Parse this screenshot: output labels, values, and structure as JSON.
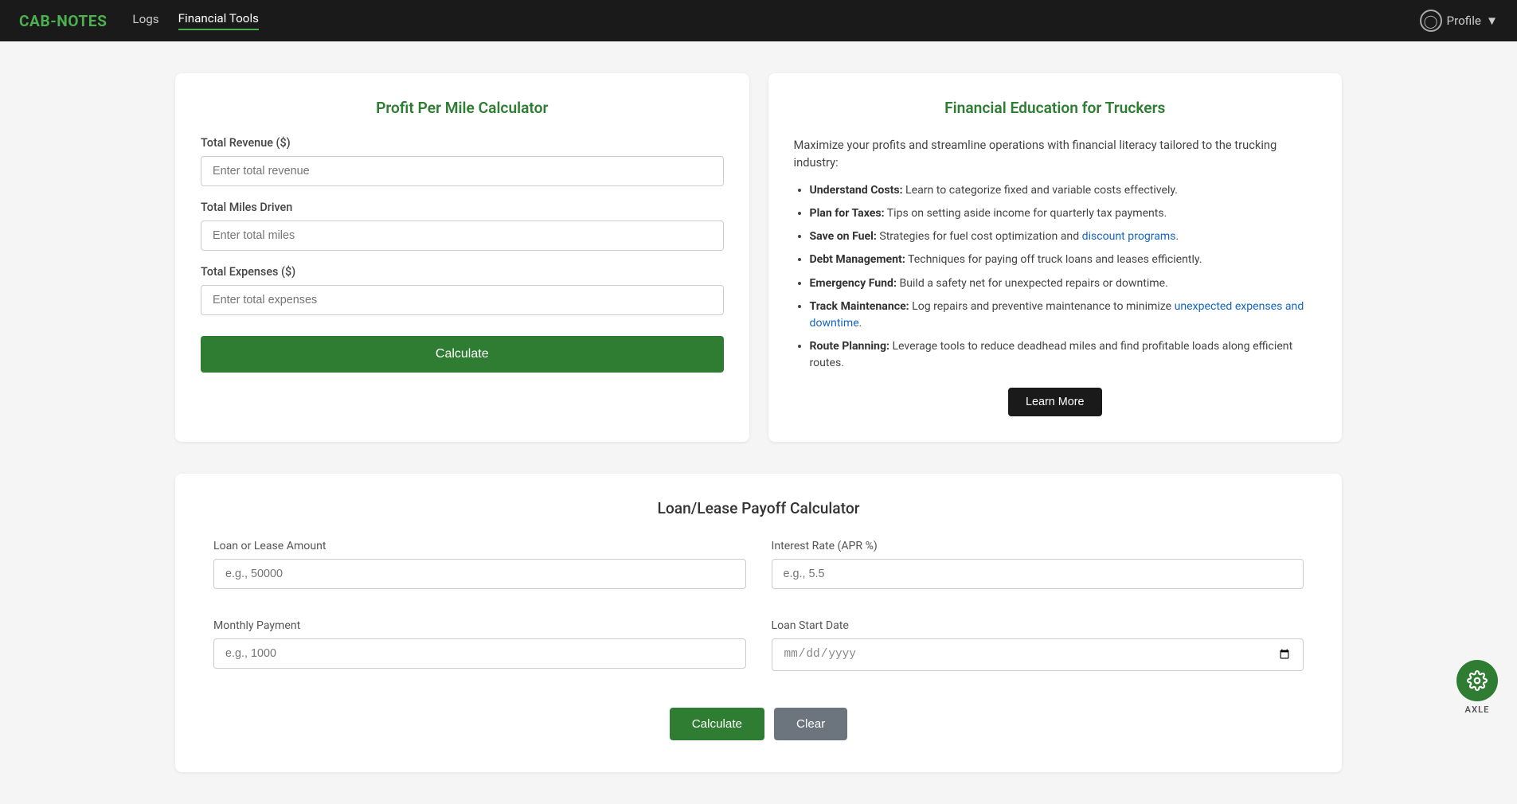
{
  "app": {
    "logo": "CAB-NOTES",
    "nav": {
      "links": [
        {
          "label": "Logs",
          "active": false
        },
        {
          "label": "Financial Tools",
          "active": true
        }
      ],
      "profile_label": "Profile"
    }
  },
  "profit_calculator": {
    "title": "Profit Per Mile Calculator",
    "fields": [
      {
        "label": "Total Revenue ($)",
        "placeholder": "Enter total revenue",
        "name": "total-revenue-input"
      },
      {
        "label": "Total Miles Driven",
        "placeholder": "Enter total miles",
        "name": "total-miles-input"
      },
      {
        "label": "Total Expenses ($)",
        "placeholder": "Enter total expenses",
        "name": "total-expenses-input"
      }
    ],
    "calculate_label": "Calculate"
  },
  "financial_education": {
    "title": "Financial Education for Truckers",
    "intro": "Maximize your profits and streamline operations with financial literacy tailored to the trucking industry:",
    "items": [
      {
        "bold": "Understand Costs:",
        "text": " Learn to categorize fixed and variable costs effectively."
      },
      {
        "bold": "Plan for Taxes:",
        "text": " Tips on setting aside income for quarterly tax payments."
      },
      {
        "bold": "Save on Fuel:",
        "text": " Strategies for fuel cost optimization and discount programs.",
        "link_word": "discount programs"
      },
      {
        "bold": "Debt Management:",
        "text": " Techniques for paying off truck loans and leases efficiently."
      },
      {
        "bold": "Emergency Fund:",
        "text": " Build a safety net for unexpected repairs or downtime."
      },
      {
        "bold": "Track Maintenance:",
        "text": " Log repairs and preventive maintenance to minimize unexpected expenses and downtime."
      },
      {
        "bold": "Route Planning:",
        "text": " Leverage tools to reduce deadhead miles and find profitable loads along efficient routes."
      }
    ],
    "learn_more_label": "Learn More"
  },
  "loan_calculator": {
    "title": "Loan/Lease Payoff Calculator",
    "fields": {
      "loan_amount_label": "Loan or Lease Amount",
      "loan_amount_placeholder": "e.g., 50000",
      "interest_rate_label": "Interest Rate (APR %)",
      "interest_rate_placeholder": "e.g., 5.5",
      "monthly_payment_label": "Monthly Payment",
      "monthly_payment_placeholder": "e.g., 1000",
      "loan_start_date_label": "Loan Start Date",
      "loan_start_date_placeholder": "mm/dd/yyyy"
    },
    "calculate_label": "Calculate",
    "clear_label": "Clear"
  },
  "axle_fab": {
    "icon": "⚙",
    "label": "AXLE"
  }
}
